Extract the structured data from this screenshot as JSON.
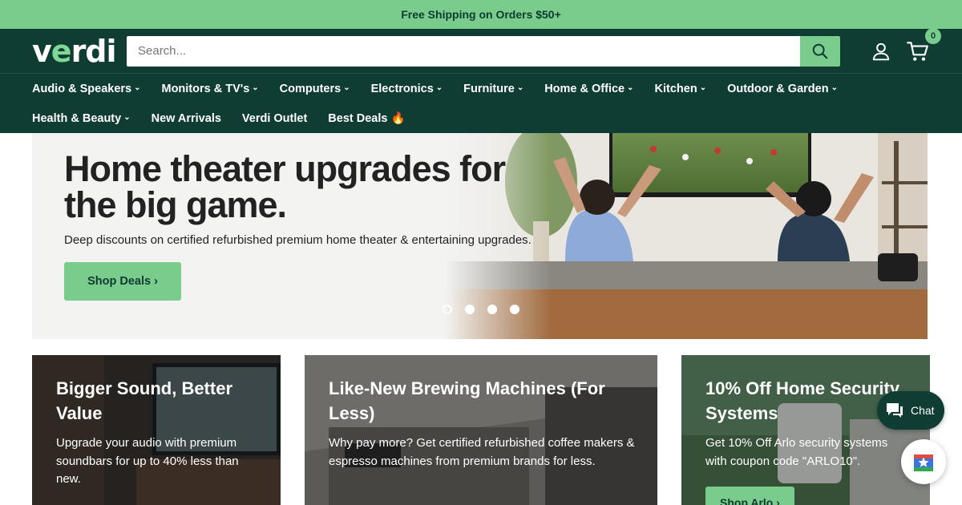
{
  "promo": {
    "text": "Free Shipping on Orders $50+"
  },
  "header": {
    "logo": {
      "prefix": "v",
      "accent": "e",
      "suffix": "rdi"
    },
    "search_placeholder": "Search...",
    "cart_count": "0"
  },
  "nav": {
    "row1": [
      {
        "label": "Audio & Speakers",
        "dropdown": true
      },
      {
        "label": "Monitors & TV's",
        "dropdown": true
      },
      {
        "label": "Computers",
        "dropdown": true
      },
      {
        "label": "Electronics",
        "dropdown": true
      },
      {
        "label": "Furniture",
        "dropdown": true
      },
      {
        "label": "Home & Office",
        "dropdown": true
      },
      {
        "label": "Kitchen",
        "dropdown": true
      },
      {
        "label": "Outdoor & Garden",
        "dropdown": true
      }
    ],
    "row2": [
      {
        "label": "Health & Beauty",
        "dropdown": true
      },
      {
        "label": "New Arrivals",
        "dropdown": false
      },
      {
        "label": "Verdi Outlet",
        "dropdown": false
      },
      {
        "label": "Best Deals 🔥",
        "dropdown": false
      }
    ],
    "chevron": "⌄"
  },
  "hero": {
    "title": "Home theater upgrades for the big game.",
    "subtitle": "Deep discounts on certified refurbished premium home theater & entertaining upgrades.",
    "button": "Shop Deals ›",
    "slide_count": 4,
    "active_slide": 1
  },
  "cards": [
    {
      "title": "Bigger Sound, Better Value",
      "text": "Upgrade your audio with premium soundbars for up to 40% less than new.",
      "button": ""
    },
    {
      "title": "Like-New Brewing Machines (For Less)",
      "text": "Why pay more? Get certified refurbished coffee makers & espresso machines from premium brands for less.",
      "button": ""
    },
    {
      "title": "10% Off Home Security Systems",
      "text": "Get 10% Off Arlo security systems with coupon code \"ARLO10\".",
      "button": "Shop Arlo ›"
    }
  ],
  "chat": {
    "label": "Chat"
  },
  "colors": {
    "brand_dark": "#0f3d33",
    "accent_green": "#79cc8c"
  }
}
